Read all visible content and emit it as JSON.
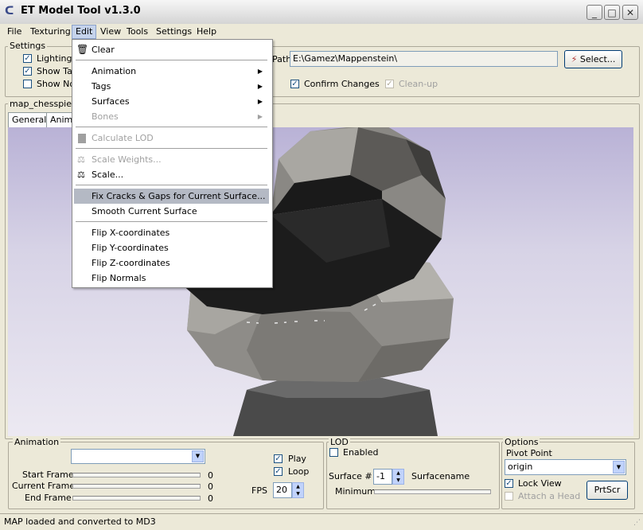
{
  "window": {
    "title": "ET Model Tool v1.3.0",
    "minimize": "_",
    "maximize": "□",
    "close": "✕"
  },
  "menubar": [
    "File",
    "Texturing",
    "Edit",
    "View",
    "Tools",
    "Settings",
    "Help"
  ],
  "settings": {
    "group_label": "Settings",
    "lighting": "Lighting",
    "show_ta": "Show Ta",
    "show_no": "Show No",
    "path_label": "Path",
    "path_value": "E:\\Gamez\\Mappenstein\\",
    "select_button": "Select...",
    "confirm_changes": "Confirm Changes",
    "cleanup": "Clean-up"
  },
  "model_name": "map_chesspiece",
  "tabs": [
    "General",
    "Anima"
  ],
  "edit_menu": {
    "clear": "Clear",
    "animation": "Animation",
    "tags": "Tags",
    "surfaces": "Surfaces",
    "bones": "Bones",
    "calculate_lod": "Calculate LOD",
    "scale_weights": "Scale Weights...",
    "scale": "Scale...",
    "fix_cracks": "Fix Cracks & Gaps for Current Surface...",
    "smooth_surface": "Smooth Current Surface",
    "flip_x": "Flip X-coordinates",
    "flip_y": "Flip Y-coordinates",
    "flip_z": "Flip Z-coordinates",
    "flip_normals": "Flip Normals"
  },
  "animation": {
    "group_label": "Animation",
    "dropdown_value": "",
    "start_frame_label": "Start Frame",
    "current_frame_label": "Current Frame",
    "end_frame_label": "End Frame",
    "start_frame_value": "0",
    "current_frame_value": "0",
    "end_frame_value": "0",
    "play": "Play",
    "loop": "Loop",
    "fps_label": "FPS",
    "fps_value": "20"
  },
  "lod": {
    "group_label": "LOD",
    "enabled": "Enabled",
    "surface_label": "Surface #",
    "surface_value": "-1",
    "surfacename_label": "Surfacename",
    "minimum_label": "Minimum"
  },
  "options": {
    "group_label": "Options",
    "pivot_label": "Pivot Point",
    "pivot_value": "origin",
    "lock_view": "Lock View",
    "attach_head": "Attach a Head",
    "prtscr": "PrtScr"
  },
  "status": "MAP loaded and converted to MD3",
  "icons": [
    "trash-icon",
    "scale-weights-icon",
    "scale-icon",
    "lod-icon",
    "lightning-icon"
  ]
}
